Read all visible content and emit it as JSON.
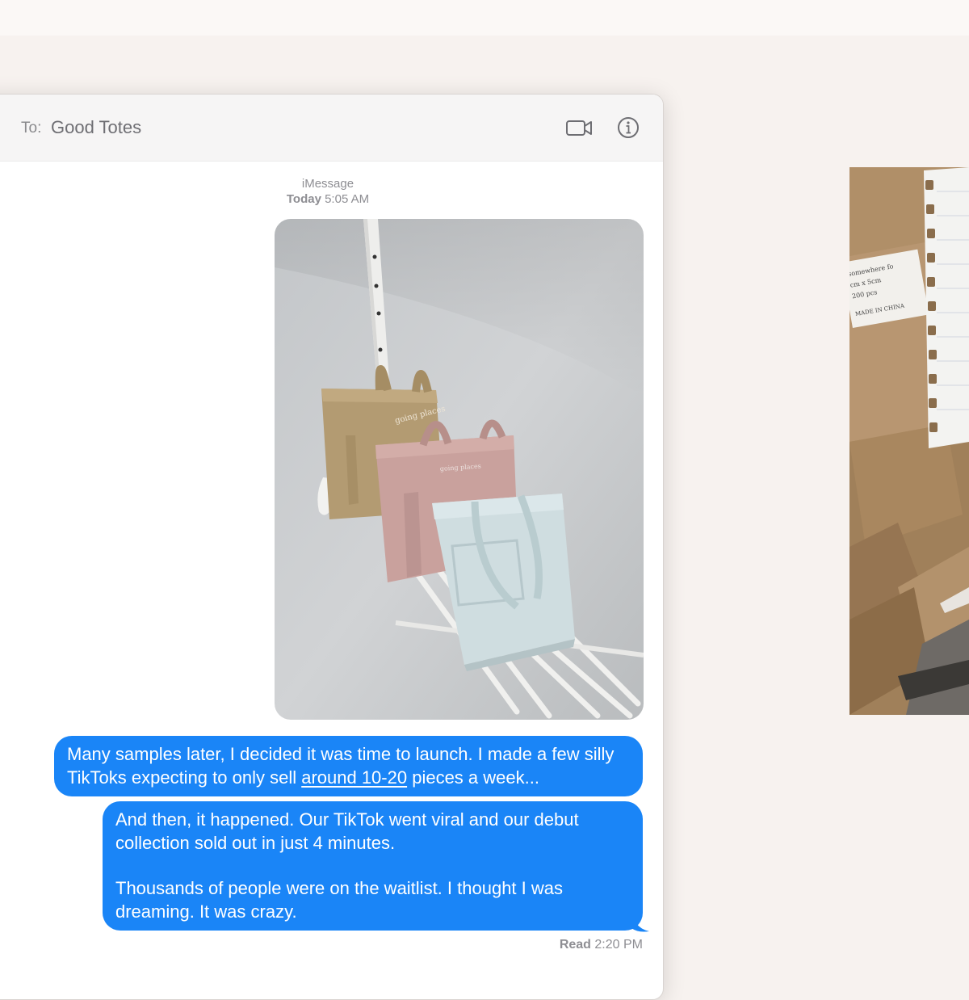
{
  "conversation": {
    "to_label": "To:",
    "recipient": "Good Totes",
    "service": "iMessage",
    "date_label": "Today",
    "time": "5:05 AM"
  },
  "header_icons": [
    "video-camera-icon",
    "info-icon"
  ],
  "photo": {
    "bag_print_1": "going places",
    "bag_print_2": "going places"
  },
  "messages": [
    {
      "part_before": "Many samples later, I decided it was time to launch. I made a few silly TikToks expecting to only sell ",
      "part_underlined": "around 10-20",
      "part_after": " pieces a week..."
    },
    {
      "para1": "And then, it happened. Our TikTok went viral and our debut collection sold out in just 4 minutes.",
      "para2": "Thousands of people were on the waitlist. I thought I was dreaming. It was crazy."
    }
  ],
  "receipt": {
    "status": "Read",
    "time": "2:20 PM"
  },
  "boxes_photo": {
    "label_line_1": "somewhere fo",
    "label_line_2": "cm x 5cm",
    "label_line_3": "200 pcs",
    "label_line_4": "MADE IN CHINA"
  },
  "colors": {
    "bubble": "#1a85f7",
    "background": "#f7f2ef",
    "meta_text": "#8e8e93"
  }
}
